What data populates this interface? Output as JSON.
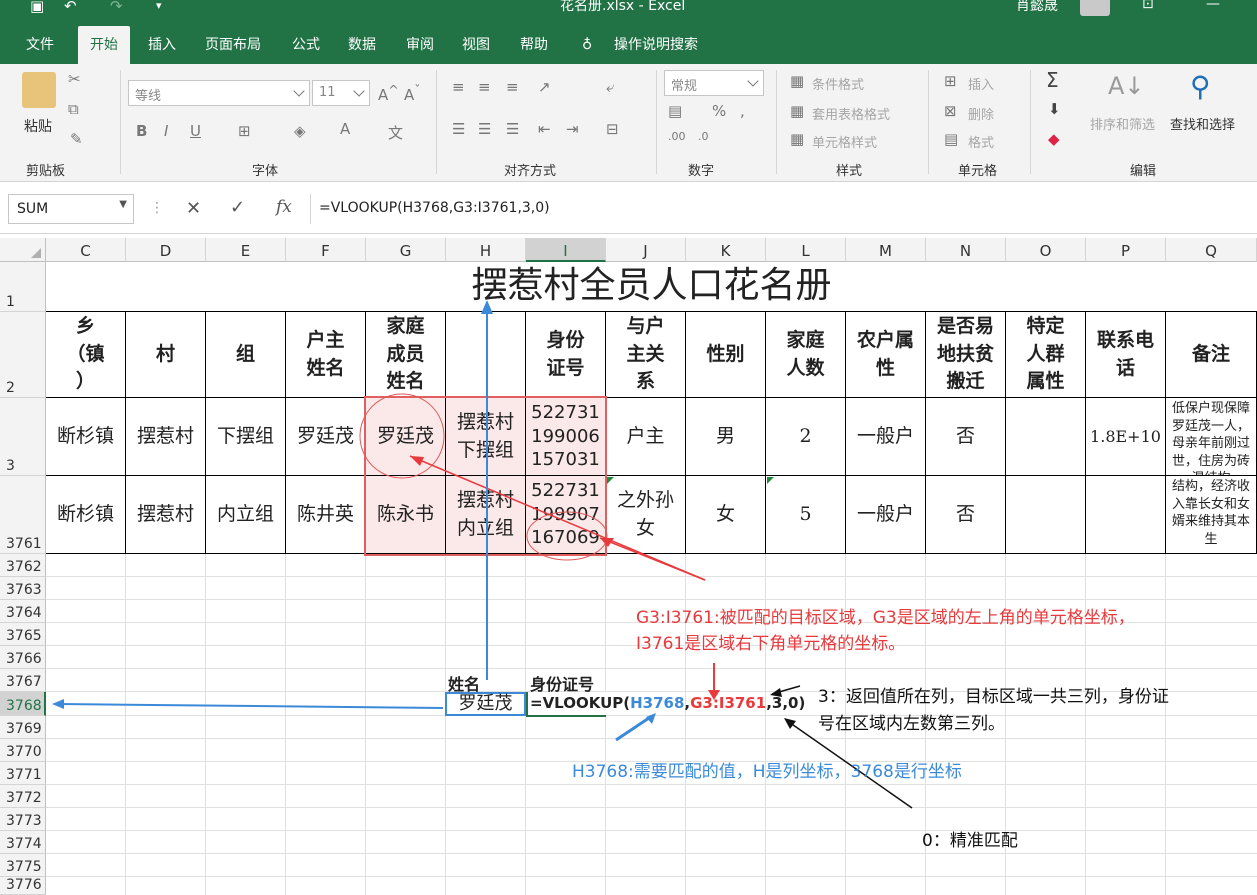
{
  "title_bar": {
    "document_title": "花名册.xlsx - Excel",
    "user_name": "肖懿晟"
  },
  "ribbon_tabs": [
    "文件",
    "开始",
    "插入",
    "页面布局",
    "公式",
    "数据",
    "审阅",
    "视图",
    "帮助",
    "操作说明搜索"
  ],
  "active_tab": "开始",
  "ribbon": {
    "paste": "粘贴",
    "clipboard_group": "剪贴板",
    "font_name": "等线",
    "font_size": "11",
    "font_group": "字体",
    "align_group": "对齐方式",
    "number_format": "常规",
    "number_group": "数字",
    "cond_format": "条件格式",
    "table_format": "套用表格格式",
    "cell_styles": "单元格样式",
    "styles_group": "样式",
    "insert": "插入",
    "delete": "删除",
    "format": "格式",
    "cells_group": "单元格",
    "sort_filter": "排序和筛选",
    "find_select": "查找和选择",
    "edit_group": "编辑"
  },
  "formula_bar": {
    "name_box": "SUM",
    "formula": "=VLOOKUP(H3768,G3:I3761,3,0)"
  },
  "columns": [
    "C",
    "D",
    "E",
    "F",
    "G",
    "H",
    "I",
    "J",
    "K",
    "L",
    "M",
    "N",
    "O",
    "P",
    "Q"
  ],
  "rows": [
    "1",
    "2",
    "3",
    "3761",
    "3762",
    "3763",
    "3764",
    "3765",
    "3766",
    "3767",
    "3768",
    "3769",
    "3770",
    "3771",
    "3772",
    "3773",
    "3774",
    "3775",
    "3776"
  ],
  "sheet_title": "摆惹村全员人口花名册",
  "table_headers": [
    "乡\n（镇\n）",
    "村",
    "组",
    "户主\n姓名",
    "家庭\n成员\n姓名",
    "",
    "身份\n证号",
    "与户\n主关\n系",
    "性别",
    "家庭\n人数",
    "农户属\n性",
    "是否易\n地扶贫\n搬迁",
    "特定\n人群\n属性",
    "联系电\n话",
    "备注"
  ],
  "table_rows": [
    [
      "断杉镇",
      "摆惹村",
      "下摆组",
      "罗廷茂",
      "罗廷茂",
      "摆惹村\n下摆组",
      "522731\n199006\n157031",
      "户主",
      "男",
      "2",
      "一般户",
      "否",
      "",
      "1.8E+10",
      "低保户现保障罗廷茂一人，母亲年前刚过世，住房为砖混结构"
    ],
    [
      "断杉镇",
      "摆惹村",
      "内立组",
      "陈井英",
      "陈永书",
      "摆惹村\n内立组",
      "522731\n199907\n167069",
      "之外孙\n女",
      "女",
      "5",
      "一般户",
      "否",
      "",
      "",
      "结构，经济收入靠长女和女婿来维持其本生"
    ]
  ],
  "lookup": {
    "name_header": "姓名",
    "id_header": "身份证号",
    "name_value": "罗廷茂",
    "formula_prefix": "=VLOOKUP(",
    "formula_h": "H3768",
    "formula_comma": ",",
    "formula_range": "G3:I3761",
    "formula_tail": ",3,0)"
  },
  "annotations": {
    "range_line1": "G3:I3761:被匹配的目标区域，G3是区域的左上角的单元格坐标，",
    "range_line2": "I3761是区域右下角单元格的坐标。",
    "col_line1": "3：返回值所在列，目标区域一共三列，身份证",
    "col_line2": "号在区域内左数第三列。",
    "lookup_value": "H3768:需要匹配的值，H是列坐标，3768是行坐标",
    "exact": "0：精准匹配"
  },
  "colors": {
    "excel_green": "#217346",
    "annotation_red": "#e8393c",
    "annotation_blue": "#3b8ad9",
    "highlight_pink": "#fbe9e9"
  }
}
